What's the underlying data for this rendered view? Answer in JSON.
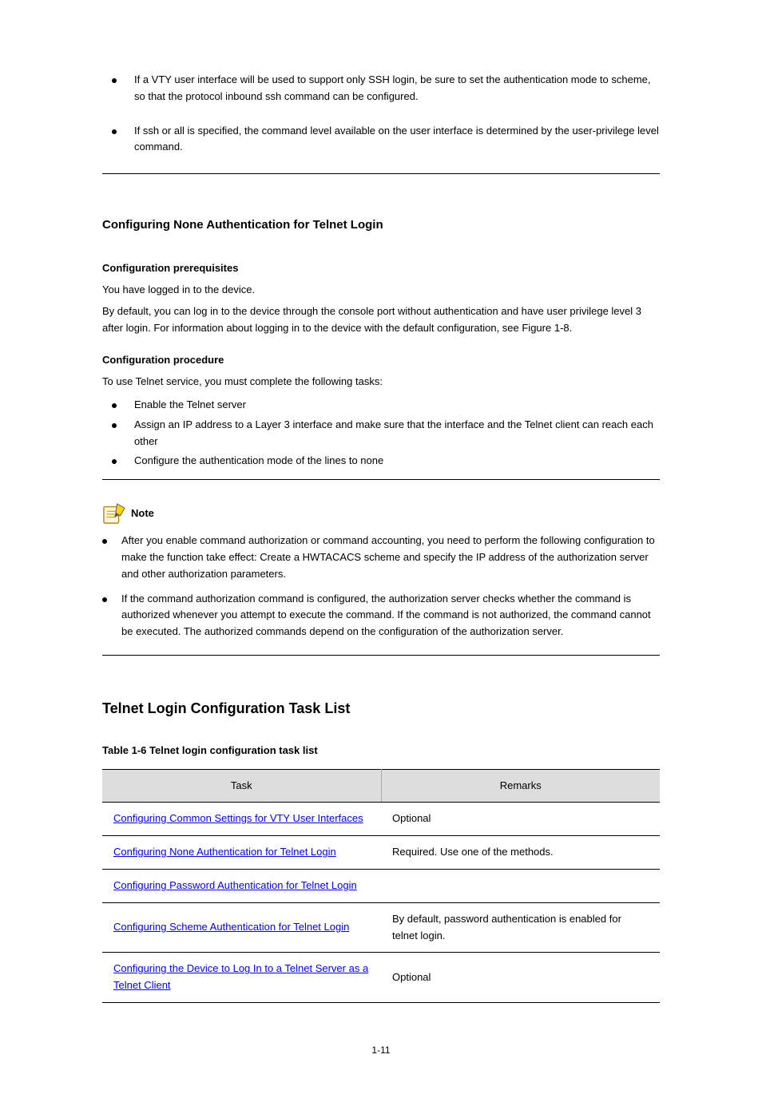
{
  "top_bullets": [
    "If a VTY user interface will be used to support only SSH login, be sure to set the authentication mode to scheme, so that the protocol inbound ssh command can be configured.",
    "If ssh or all is specified, the command level available on the user interface is determined by the user-privilege level command."
  ],
  "heading_main": "Configuring None Authentication for Telnet Login",
  "main_paragraphs": [
    "Configuration prerequisites",
    "You have logged in to the device.",
    "By default, you can log in to the device through the console port without authentication and have user privilege level 3 after login. For information about logging in to the device with the default configuration, see Figure 1-8.",
    "Configuration procedure",
    "To use Telnet service, you must complete the following tasks:"
  ],
  "question_bullets": [
    "Enable the Telnet server",
    "Assign an IP address to a Layer 3 interface and make sure that the interface and the Telnet client can reach each other",
    "Configure the authentication mode of the lines to none"
  ],
  "note_label": "Note",
  "note_bullets": [
    "After you enable command authorization or command accounting, you need to perform the following configuration to make the function take effect: Create a HWTACACS scheme and specify the IP address of the authorization server and other authorization parameters.",
    "If the command authorization command is configured, the authorization server checks whether the command is authorized whenever you attempt to execute the command. If the command is not authorized, the command cannot be executed. The authorized commands depend on the configuration of the authorization server."
  ],
  "heading_sub": "Telnet Login Configuration Task List",
  "table_caption": "Table 1-6 Telnet login configuration task list",
  "table": {
    "headers": [
      "Task",
      "Remarks"
    ],
    "rows": [
      {
        "task_link": "Configuring Common Settings for VTY User Interfaces",
        "task_suffix": "",
        "remarks": "Optional"
      },
      {
        "task_link": "Configuring None Authentication for Telnet Login",
        "task_suffix": "",
        "remarks": "Required. Use one of the methods."
      },
      {
        "task_link": "Configuring Password Authentication for Telnet Login",
        "task_suffix": "",
        "remarks": ""
      },
      {
        "task_link": "Configuring Scheme Authentication for Telnet Login",
        "task_suffix": "",
        "remarks": "By default, password authentication is enabled for telnet login."
      },
      {
        "task_link": "Configuring the Device to Log In to a Telnet Server as a Telnet Client",
        "task_suffix": "",
        "remarks": "Optional"
      }
    ]
  },
  "page_number": "1-11"
}
